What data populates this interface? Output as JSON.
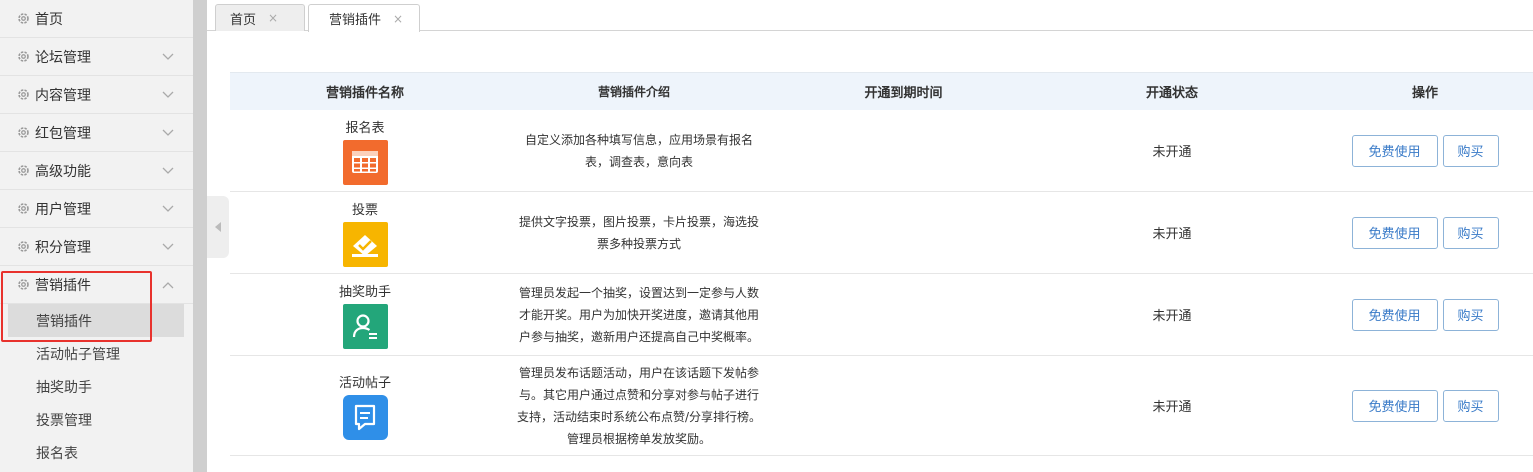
{
  "sidebar": {
    "items": [
      {
        "label": "首页"
      },
      {
        "label": "论坛管理"
      },
      {
        "label": "内容管理"
      },
      {
        "label": "红包管理"
      },
      {
        "label": "高级功能"
      },
      {
        "label": "用户管理"
      },
      {
        "label": "积分管理"
      },
      {
        "label": "营销插件"
      }
    ],
    "submenu": [
      {
        "label": "营销插件"
      },
      {
        "label": "活动帖子管理"
      },
      {
        "label": "抽奖助手"
      },
      {
        "label": "投票管理"
      },
      {
        "label": "报名表"
      }
    ]
  },
  "tabs": [
    {
      "label": "首页",
      "close": "×"
    },
    {
      "label": "营销插件",
      "close": "×"
    }
  ],
  "table": {
    "headers": {
      "name": "营销插件名称",
      "intro": "营销插件介绍",
      "expire": "开通到期时间",
      "status": "开通状态",
      "ops": "操作"
    },
    "rows": [
      {
        "name": "报名表",
        "intro": "自定义添加各种填写信息，应用场景有报名表，调查表，意向表",
        "expire": "",
        "status": "未开通",
        "free": "免费使用",
        "buy": "购买",
        "icon": "form-table-icon",
        "color": "#f26b2d"
      },
      {
        "name": "投票",
        "intro": "提供文字投票，图片投票，卡片投票，海选投票多种投票方式",
        "expire": "",
        "status": "未开通",
        "free": "免费使用",
        "buy": "购买",
        "icon": "vote-icon",
        "color": "#f7b500"
      },
      {
        "name": "抽奖助手",
        "intro": "管理员发起一个抽奖，设置达到一定参与人数才能开奖。用户为加快开奖进度，邀请其他用户参与抽奖，邀新用户还提高自己中奖概率。",
        "expire": "",
        "status": "未开通",
        "free": "免费使用",
        "buy": "购买",
        "icon": "lottery-user-icon",
        "color": "#23a67a"
      },
      {
        "name": "活动帖子",
        "intro": "管理员发布话题活动，用户在该话题下发帖参与。其它用户通过点赞和分享对参与帖子进行支持，活动结束时系统公布点赞/分享排行榜。管理员根据榜单发放奖励。",
        "expire": "",
        "status": "未开通",
        "free": "免费使用",
        "buy": "购买",
        "icon": "activity-post-icon",
        "color": "#2f8fe8"
      }
    ]
  },
  "colors": {
    "highlight": "#e8322d",
    "button": "#3a7bc8"
  }
}
